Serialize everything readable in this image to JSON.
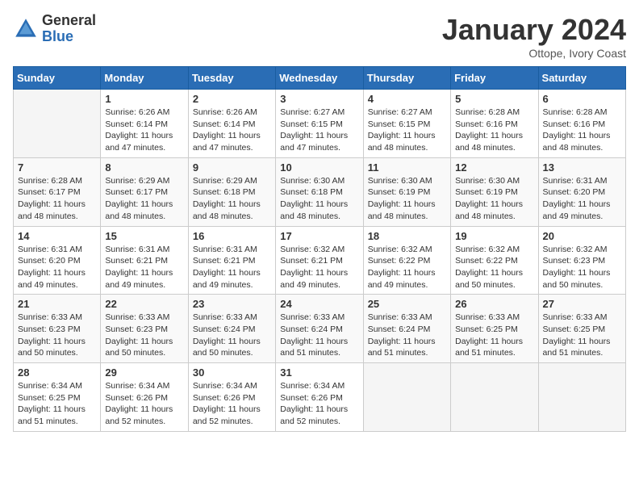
{
  "header": {
    "logo": {
      "line1": "General",
      "line2": "Blue"
    },
    "title": "January 2024",
    "location": "Ottope, Ivory Coast"
  },
  "weekdays": [
    "Sunday",
    "Monday",
    "Tuesday",
    "Wednesday",
    "Thursday",
    "Friday",
    "Saturday"
  ],
  "weeks": [
    [
      {
        "day": null
      },
      {
        "day": 1,
        "sunrise": "6:26 AM",
        "sunset": "6:14 PM",
        "daylight": "11 hours and 47 minutes."
      },
      {
        "day": 2,
        "sunrise": "6:26 AM",
        "sunset": "6:14 PM",
        "daylight": "11 hours and 47 minutes."
      },
      {
        "day": 3,
        "sunrise": "6:27 AM",
        "sunset": "6:15 PM",
        "daylight": "11 hours and 47 minutes."
      },
      {
        "day": 4,
        "sunrise": "6:27 AM",
        "sunset": "6:15 PM",
        "daylight": "11 hours and 48 minutes."
      },
      {
        "day": 5,
        "sunrise": "6:28 AM",
        "sunset": "6:16 PM",
        "daylight": "11 hours and 48 minutes."
      },
      {
        "day": 6,
        "sunrise": "6:28 AM",
        "sunset": "6:16 PM",
        "daylight": "11 hours and 48 minutes."
      }
    ],
    [
      {
        "day": 7,
        "sunrise": "6:28 AM",
        "sunset": "6:17 PM",
        "daylight": "11 hours and 48 minutes."
      },
      {
        "day": 8,
        "sunrise": "6:29 AM",
        "sunset": "6:17 PM",
        "daylight": "11 hours and 48 minutes."
      },
      {
        "day": 9,
        "sunrise": "6:29 AM",
        "sunset": "6:18 PM",
        "daylight": "11 hours and 48 minutes."
      },
      {
        "day": 10,
        "sunrise": "6:30 AM",
        "sunset": "6:18 PM",
        "daylight": "11 hours and 48 minutes."
      },
      {
        "day": 11,
        "sunrise": "6:30 AM",
        "sunset": "6:19 PM",
        "daylight": "11 hours and 48 minutes."
      },
      {
        "day": 12,
        "sunrise": "6:30 AM",
        "sunset": "6:19 PM",
        "daylight": "11 hours and 48 minutes."
      },
      {
        "day": 13,
        "sunrise": "6:31 AM",
        "sunset": "6:20 PM",
        "daylight": "11 hours and 49 minutes."
      }
    ],
    [
      {
        "day": 14,
        "sunrise": "6:31 AM",
        "sunset": "6:20 PM",
        "daylight": "11 hours and 49 minutes."
      },
      {
        "day": 15,
        "sunrise": "6:31 AM",
        "sunset": "6:21 PM",
        "daylight": "11 hours and 49 minutes."
      },
      {
        "day": 16,
        "sunrise": "6:31 AM",
        "sunset": "6:21 PM",
        "daylight": "11 hours and 49 minutes."
      },
      {
        "day": 17,
        "sunrise": "6:32 AM",
        "sunset": "6:21 PM",
        "daylight": "11 hours and 49 minutes."
      },
      {
        "day": 18,
        "sunrise": "6:32 AM",
        "sunset": "6:22 PM",
        "daylight": "11 hours and 49 minutes."
      },
      {
        "day": 19,
        "sunrise": "6:32 AM",
        "sunset": "6:22 PM",
        "daylight": "11 hours and 50 minutes."
      },
      {
        "day": 20,
        "sunrise": "6:32 AM",
        "sunset": "6:23 PM",
        "daylight": "11 hours and 50 minutes."
      }
    ],
    [
      {
        "day": 21,
        "sunrise": "6:33 AM",
        "sunset": "6:23 PM",
        "daylight": "11 hours and 50 minutes."
      },
      {
        "day": 22,
        "sunrise": "6:33 AM",
        "sunset": "6:23 PM",
        "daylight": "11 hours and 50 minutes."
      },
      {
        "day": 23,
        "sunrise": "6:33 AM",
        "sunset": "6:24 PM",
        "daylight": "11 hours and 50 minutes."
      },
      {
        "day": 24,
        "sunrise": "6:33 AM",
        "sunset": "6:24 PM",
        "daylight": "11 hours and 51 minutes."
      },
      {
        "day": 25,
        "sunrise": "6:33 AM",
        "sunset": "6:24 PM",
        "daylight": "11 hours and 51 minutes."
      },
      {
        "day": 26,
        "sunrise": "6:33 AM",
        "sunset": "6:25 PM",
        "daylight": "11 hours and 51 minutes."
      },
      {
        "day": 27,
        "sunrise": "6:33 AM",
        "sunset": "6:25 PM",
        "daylight": "11 hours and 51 minutes."
      }
    ],
    [
      {
        "day": 28,
        "sunrise": "6:34 AM",
        "sunset": "6:25 PM",
        "daylight": "11 hours and 51 minutes."
      },
      {
        "day": 29,
        "sunrise": "6:34 AM",
        "sunset": "6:26 PM",
        "daylight": "11 hours and 52 minutes."
      },
      {
        "day": 30,
        "sunrise": "6:34 AM",
        "sunset": "6:26 PM",
        "daylight": "11 hours and 52 minutes."
      },
      {
        "day": 31,
        "sunrise": "6:34 AM",
        "sunset": "6:26 PM",
        "daylight": "11 hours and 52 minutes."
      },
      {
        "day": null
      },
      {
        "day": null
      },
      {
        "day": null
      }
    ]
  ],
  "labels": {
    "sunrise_prefix": "Sunrise: ",
    "sunset_prefix": "Sunset: ",
    "daylight_prefix": "Daylight: "
  }
}
